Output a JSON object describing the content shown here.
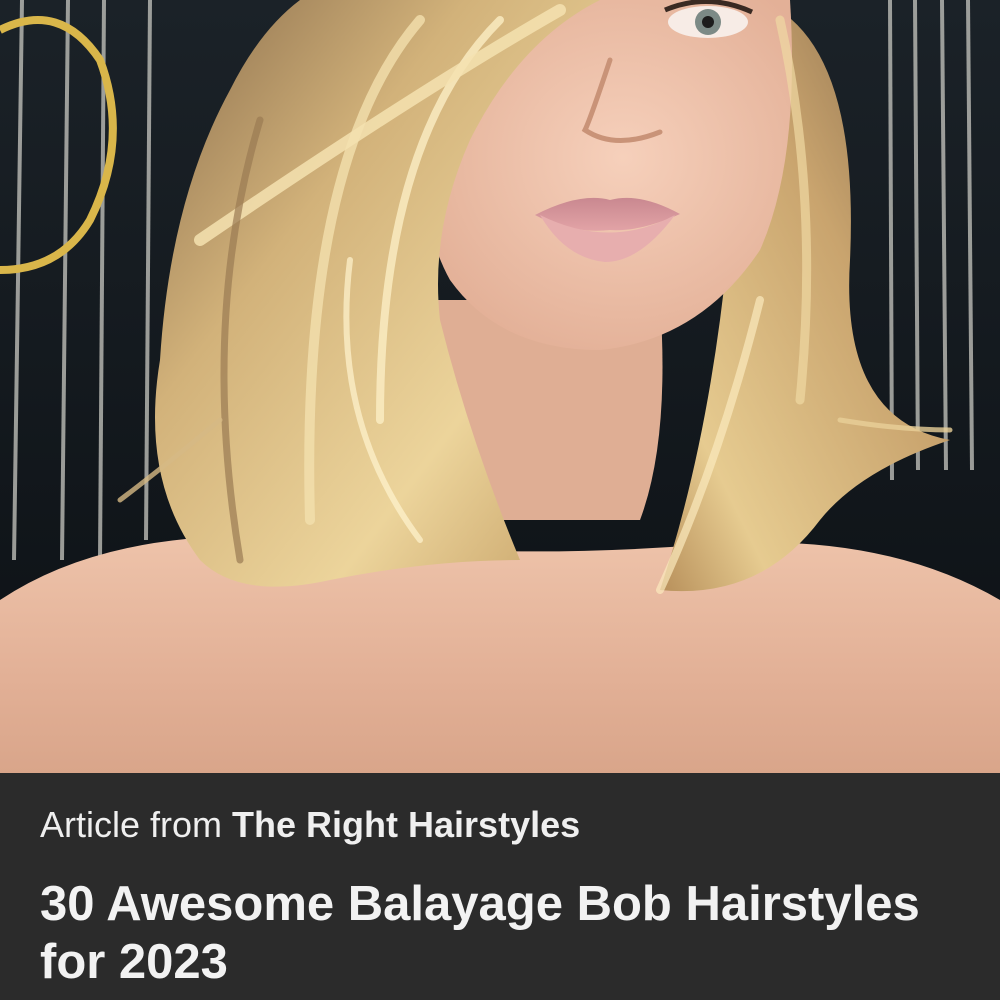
{
  "pin": {
    "image_alt": "Woman with a layered blonde balayage bob haircut",
    "source_prefix": "Article from",
    "source_name": "The Right Hairstyles",
    "title": "30 Awesome Balayage Bob Hairstyles for 2023"
  },
  "colors": {
    "panel_background": "#2b2b2b",
    "text": "#f2f2f2",
    "hair": "#d8b676",
    "skin": "#e3b49c",
    "backdrop": "#0f1418"
  }
}
